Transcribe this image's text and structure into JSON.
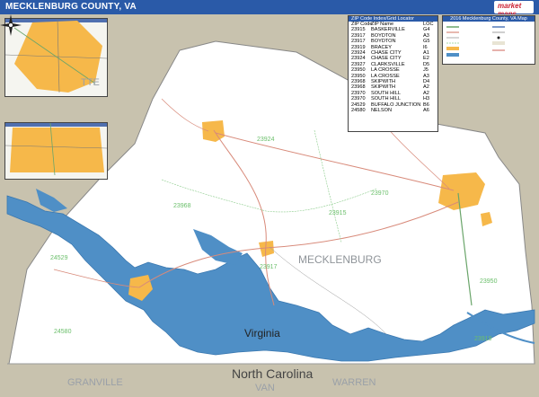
{
  "header": {
    "title": "MECKLENBURG COUNTY, VA",
    "logo_text": "market maps"
  },
  "map_labels": {
    "county": "MECKLENBURG",
    "state": "Virginia",
    "state_south": "North Carolina",
    "county_sw": "GRANVILLE",
    "county_se": "WARREN",
    "county_s_partial": "VAN",
    "county_nw_partial": "TTE"
  },
  "zip_labels": [
    "23924",
    "23970",
    "23968",
    "23915",
    "24529",
    "23917",
    "23950",
    "24580",
    "23919"
  ],
  "zip_table": {
    "header": "ZIP Code Index/Grid Locator",
    "columns": [
      "ZIP Code",
      "ZIP Name",
      "LOC"
    ],
    "rows": [
      [
        "23915",
        "BASKERVILLE",
        "G4"
      ],
      [
        "23917",
        "BOYDTON",
        "A3"
      ],
      [
        "23917",
        "BOYDTON",
        "G5"
      ],
      [
        "23919",
        "BRACEY",
        "I6"
      ],
      [
        "23924",
        "CHASE CITY",
        "A1"
      ],
      [
        "23924",
        "CHASE CITY",
        "E2"
      ],
      [
        "23927",
        "CLARKSVILLE",
        "D5"
      ],
      [
        "23950",
        "LA CROSSE",
        "J5"
      ],
      [
        "23950",
        "LA CROSSE",
        "A3"
      ],
      [
        "23968",
        "SKIPWITH",
        "D4"
      ],
      [
        "23968",
        "SKIPWITH",
        "A2"
      ],
      [
        "23970",
        "SOUTH HILL",
        "A2"
      ],
      [
        "23970",
        "SOUTH HILL",
        "H3"
      ],
      [
        "24529",
        "BUFFALO JUNCTION",
        "B6"
      ],
      [
        "24580",
        "NELSON",
        "A6"
      ]
    ]
  },
  "legend": {
    "header": "2016 Mecklenburg County, VA Map"
  },
  "colors": {
    "water": "#4f8fc6",
    "county_fill": "#ffffff",
    "surround": "#c8c2ae",
    "urban": "#f6b84a",
    "title_bar": "#2a5aa8",
    "zip_text": "#6bbf6b"
  },
  "icons": [
    "compass-rose-icon"
  ]
}
